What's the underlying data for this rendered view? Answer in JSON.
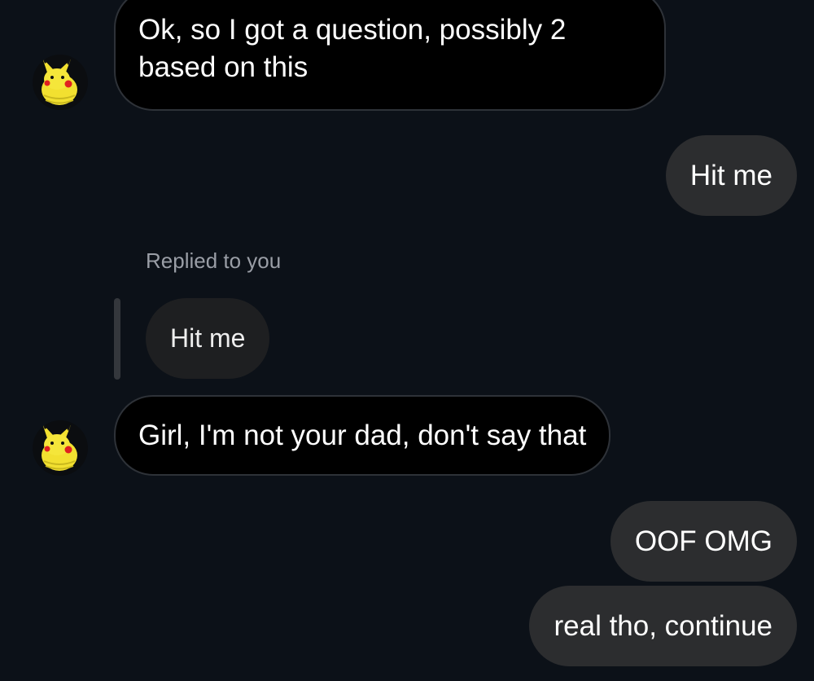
{
  "conversation": {
    "messages": [
      {
        "sender": "other",
        "text_line1": "Ok, so I got a question, possibly 2",
        "text_line2": "based on this"
      },
      {
        "sender": "me",
        "text": "Hit me"
      },
      {
        "sender": "other",
        "reply_label": "Replied to you",
        "quoted_text": "Hit me",
        "text": "Girl, I'm not your dad, don't say that"
      },
      {
        "sender": "me",
        "text": "OOF OMG"
      },
      {
        "sender": "me",
        "text": "real tho, continue"
      }
    ]
  },
  "avatar": {
    "icon": "pikachu-plush-avatar",
    "colors": {
      "yellow": "#f2e030",
      "cheek": "#e02020",
      "ear_tip": "#111111"
    }
  },
  "colors": {
    "background": "#0c1118",
    "incoming_bubble": "#000000",
    "incoming_border": "#2e3238",
    "outgoing_bubble": "#2c2d2f",
    "quoted_bubble": "#1e1f21",
    "reply_label": "#9a9ea6"
  }
}
